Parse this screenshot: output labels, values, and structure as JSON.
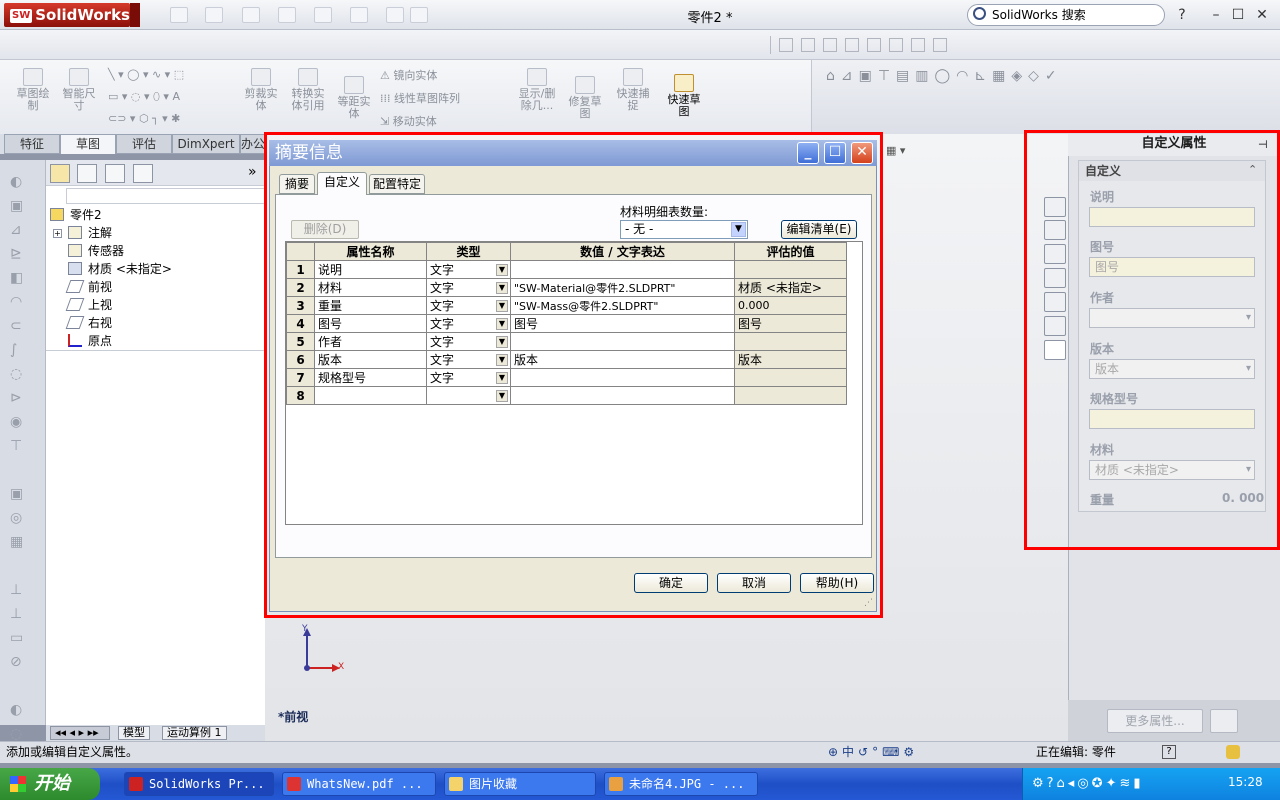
{
  "app": {
    "logo": "SolidWorks",
    "logo_badge": "SW",
    "doc_title": "零件2 *",
    "search_placeholder": "SolidWorks 搜索",
    "help_icon": "?",
    "win_min": "–",
    "win_max": "☐",
    "win_close": "✕"
  },
  "command_manager": {
    "items": [
      {
        "label": "草图绘\n制"
      },
      {
        "label": "智能尺\n寸"
      },
      {
        "label": "剪裁实\n体"
      },
      {
        "label": "转换实\n体引用"
      },
      {
        "label": "等距实\n体"
      },
      {
        "label": "显示/删\n除几..."
      },
      {
        "label": "修复草\n图"
      },
      {
        "label": "快速捕\n捉"
      },
      {
        "label": "快速草\n图"
      }
    ],
    "small_items": [
      "镜向实体",
      "线性草图阵列",
      "移动实体"
    ]
  },
  "cm_tabs": [
    "特征",
    "草图",
    "评估",
    "DimXpert",
    "办公"
  ],
  "cm_active_tab": "草图",
  "tree": {
    "expander": "+",
    "items": [
      {
        "label": "零件2"
      },
      {
        "label": "注解"
      },
      {
        "label": "传感器"
      },
      {
        "label": "材质 <未指定>"
      },
      {
        "label": "前视"
      },
      {
        "label": "上视"
      },
      {
        "label": "右视"
      },
      {
        "label": "原点"
      }
    ],
    "panel_arrow": "»"
  },
  "bottom_tabs": [
    "模型",
    "运动算例 1"
  ],
  "view_label": "*前视",
  "triad": {
    "y": "Y",
    "x": "X"
  },
  "dialog": {
    "title": "摘要信息",
    "tabs": [
      "摘要",
      "自定义",
      "配置特定"
    ],
    "active_tab": "自定义",
    "delete_button": "删除(D)",
    "bom_label": "材料明细表数量:",
    "bom_value": "- 无 -",
    "edit_list_button": "编辑清单(E)",
    "columns": [
      "",
      "属性名称",
      "类型",
      "数值 / 文字表达",
      "评估的值"
    ],
    "rows": [
      {
        "n": "1",
        "name": "说明",
        "type": "文字",
        "value": "",
        "eval": ""
      },
      {
        "n": "2",
        "name": "材料",
        "type": "文字",
        "value": "\"SW-Material@零件2.SLDPRT\"",
        "eval": "材质 <未指定>"
      },
      {
        "n": "3",
        "name": "重量",
        "type": "文字",
        "value": "\"SW-Mass@零件2.SLDPRT\"",
        "eval": "0.000"
      },
      {
        "n": "4",
        "name": "图号",
        "type": "文字",
        "value": "图号",
        "eval": "图号"
      },
      {
        "n": "5",
        "name": "作者",
        "type": "文字",
        "value": "",
        "eval": ""
      },
      {
        "n": "6",
        "name": "版本",
        "type": "文字",
        "value": "版本",
        "eval": "版本"
      },
      {
        "n": "7",
        "name": "规格型号",
        "type": "文字",
        "value": "",
        "eval": ""
      },
      {
        "n": "8",
        "name": "",
        "type": "",
        "value": "",
        "eval": ""
      }
    ],
    "ok": "确定",
    "cancel": "取消",
    "help": "帮助(H)"
  },
  "task_pane": {
    "title": "自定义属性",
    "group_title": "自定义",
    "fields": [
      {
        "label": "说明",
        "value": "",
        "dropdown": false
      },
      {
        "label": "图号",
        "value": "图号",
        "dropdown": false
      },
      {
        "label": "作者",
        "value": "",
        "dropdown": true
      },
      {
        "label": "版本",
        "value": "版本",
        "dropdown": true
      },
      {
        "label": "规格型号",
        "value": "",
        "dropdown": false
      },
      {
        "label": "材料",
        "value": "材质 <未指定>",
        "dropdown": true
      }
    ],
    "weight_label": "重量",
    "weight_value": "0. 000",
    "more_button": "更多属性..."
  },
  "status": {
    "left": "添加或编辑自定义属性。",
    "editing": "正在编辑: 零件",
    "help_icon": "?"
  },
  "taskbar": {
    "start": "开始",
    "tasks": [
      "SolidWorks Pr...",
      "WhatsNew.pdf ...",
      "图片收藏",
      "未命名4.JPG - ..."
    ],
    "clock": "15:28"
  },
  "colors": {
    "highlight": "#ff0000",
    "dialog_title": "#7e99d4",
    "taskbar": "#2458d4"
  }
}
